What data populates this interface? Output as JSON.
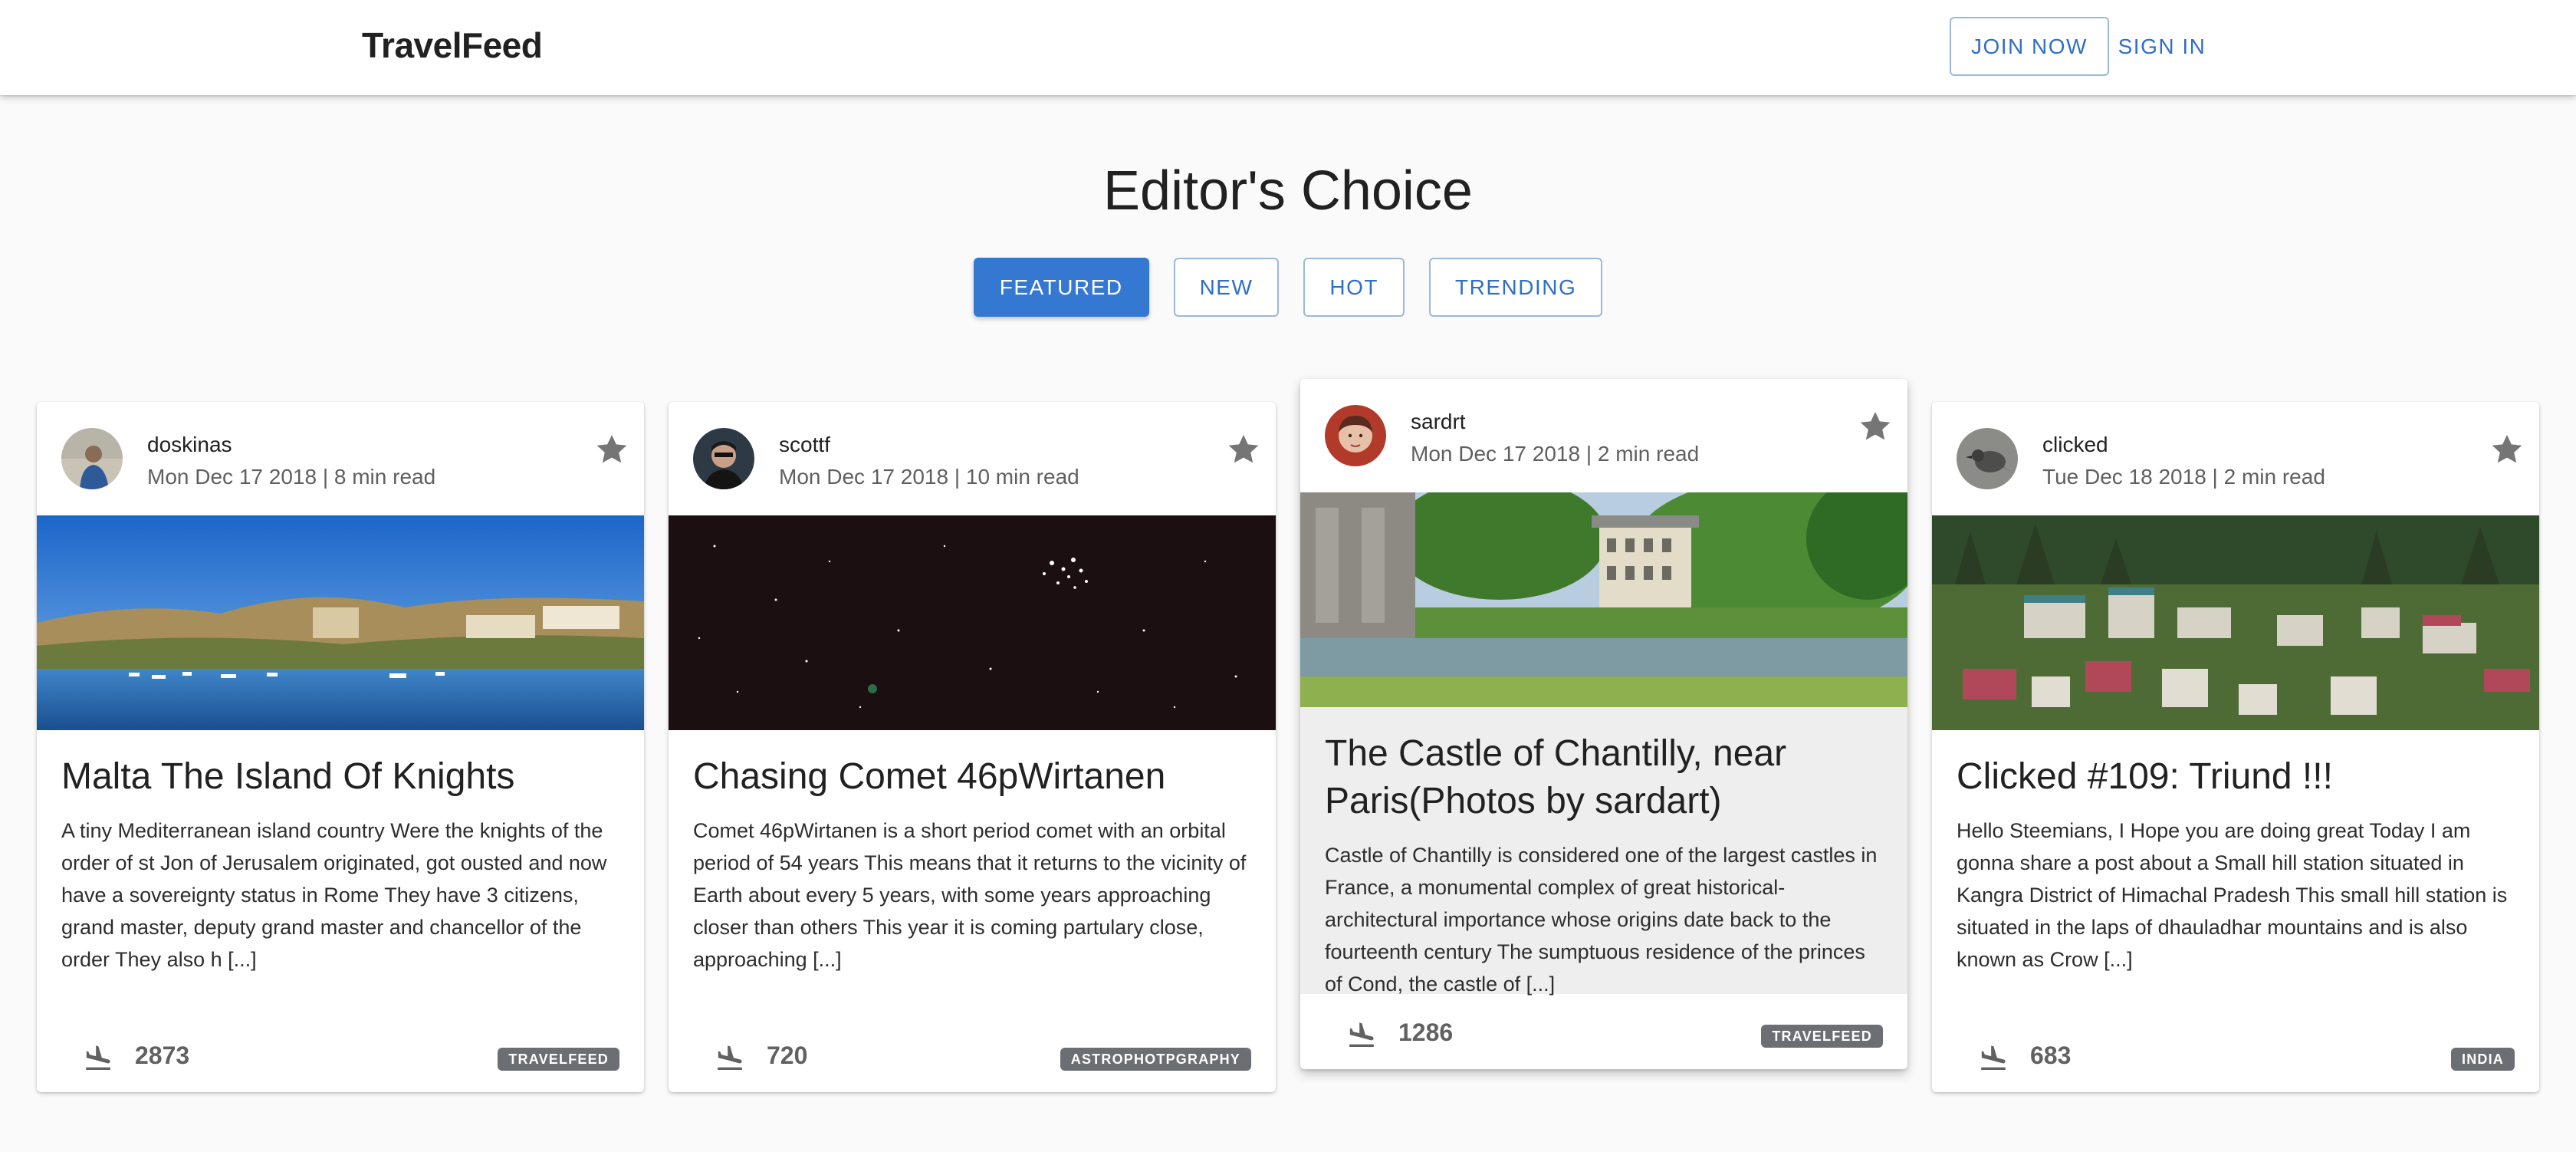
{
  "header": {
    "brand": "TravelFeed",
    "join_label": "JOIN NOW",
    "signin_label": "SIGN IN"
  },
  "page": {
    "title": "Editor's Choice"
  },
  "tabs": [
    {
      "label": "FEATURED",
      "active": true
    },
    {
      "label": "NEW",
      "active": false
    },
    {
      "label": "HOT",
      "active": false
    },
    {
      "label": "TRENDING",
      "active": false
    }
  ],
  "cards": [
    {
      "author": "doskinas",
      "meta": "Mon Dec 17 2018 | 8 min read",
      "title": "Malta The Island Of Knights",
      "excerpt": "A tiny Mediterranean island country Were the knights of the order of st Jon of Jerusalem originated, got ousted and now have a sovereignty status in Rome They have 3 citizens, grand master, deputy grand master and chancellor of the order They also h [...]",
      "count": "2873",
      "tag": "TRAVELFEED",
      "star_icon": "star-icon",
      "stat_icon": "airplane-landing-icon"
    },
    {
      "author": "scottf",
      "meta": "Mon Dec 17 2018 | 10 min read",
      "title": "Chasing Comet 46pWirtanen",
      "excerpt": "Comet 46pWirtanen is a short period comet with an orbital period of 54 years This means that it returns to the vicinity of Earth about every 5 years, with some years approaching closer than others This year it is coming partulary close, approaching [...]",
      "count": "720",
      "tag": "ASTROPHOTPGRAPHY",
      "star_icon": "star-icon",
      "stat_icon": "airplane-landing-icon"
    },
    {
      "author": "sardrt",
      "meta": "Mon Dec 17 2018 | 2 min read",
      "title": "The Castle of Chantilly, near Paris(Photos by sardart)",
      "excerpt": "Castle of Chantilly is considered one of the largest castles in France, a monumental complex of great historical-architectural importance whose origins date back to the fourteenth century The sumptuous residence of the princes of Cond, the castle of [...]",
      "count": "1286",
      "tag": "TRAVELFEED",
      "star_icon": "star-icon",
      "stat_icon": "airplane-landing-icon"
    },
    {
      "author": "clicked",
      "meta": "Tue Dec 18 2018 | 2 min read",
      "title": "Clicked #109: Triund !!!",
      "excerpt": "Hello Steemians, I Hope you are doing great Today I am gonna share a post about a Small hill station situated in Kangra District of Himachal Pradesh This small hill station is situated in the laps of dhauladhar mountains and is also known as Crow [...]",
      "count": "683",
      "tag": "INDIA",
      "star_icon": "star-icon",
      "stat_icon": "airplane-landing-icon"
    }
  ],
  "colors": {
    "accent": "#3578d2",
    "tag_bg": "#6b6e73",
    "star": "#757575"
  }
}
